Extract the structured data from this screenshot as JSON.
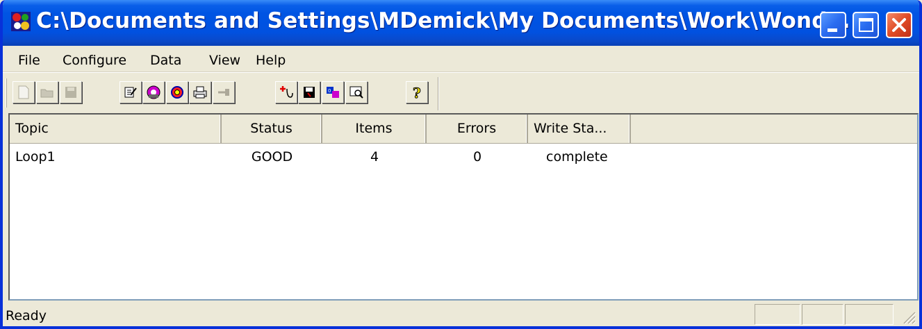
{
  "window": {
    "title": "C:\\Documents and Settings\\MDemick\\My Documents\\Work\\Wonde..."
  },
  "menu": {
    "items": [
      "File",
      "Configure",
      "Data",
      "View",
      "Help"
    ]
  },
  "toolbar": {
    "buttons": [
      {
        "icon": "new-document-icon",
        "enabled": false
      },
      {
        "icon": "open-folder-icon",
        "enabled": false
      },
      {
        "icon": "save-disk-icon",
        "enabled": false
      },
      {
        "icon": "edit-configure-icon",
        "enabled": true
      },
      {
        "icon": "topic-definition-icon",
        "enabled": true
      },
      {
        "icon": "settings-gear-icon",
        "enabled": true
      },
      {
        "icon": "print-icon",
        "enabled": true
      },
      {
        "icon": "connect-icon",
        "enabled": false
      },
      {
        "icon": "add-item-icon",
        "enabled": true
      },
      {
        "icon": "save-data-icon",
        "enabled": true
      },
      {
        "icon": "data-block-icon",
        "enabled": true
      },
      {
        "icon": "view-monitor-icon",
        "enabled": true
      },
      {
        "icon": "help-question-icon",
        "enabled": true
      }
    ]
  },
  "table": {
    "columns": [
      "Topic",
      "Status",
      "Items",
      "Errors",
      "Write Sta..."
    ],
    "rows": [
      {
        "topic": "Loop1",
        "status": "GOOD",
        "items": "4",
        "errors": "0",
        "write_status": "complete"
      }
    ]
  },
  "statusbar": {
    "text": "Ready"
  },
  "colors": {
    "titlebar": "#0054e3",
    "window_border": "#0831d9",
    "close_button": "#e04c26",
    "face": "#ece9d8"
  }
}
